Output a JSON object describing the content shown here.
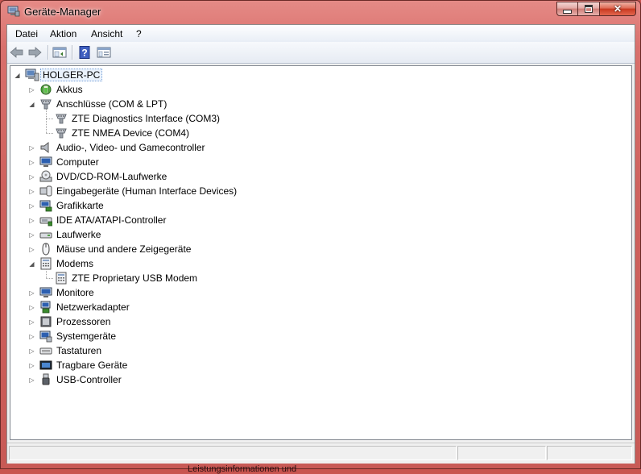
{
  "window": {
    "title": "Geräte-Manager",
    "caption": {
      "minimize": "minimize",
      "maximize": "maximize",
      "close": "close"
    }
  },
  "menu": [
    "Datei",
    "Aktion",
    "Ansicht",
    "?"
  ],
  "toolbar": {
    "buttons": [
      "back-arrow-icon",
      "forward-arrow-icon",
      "show-hide-console-tree-icon",
      "help-icon",
      "properties-view-icon"
    ]
  },
  "tree": {
    "root": {
      "label": "HOLGER-PC",
      "icon": "computer-icon",
      "expanded": true,
      "selected": true
    },
    "items": [
      {
        "label": "Akkus",
        "icon": "battery-icon",
        "expanded": false,
        "level": 1
      },
      {
        "label": "Anschlüsse (COM & LPT)",
        "icon": "port-icon",
        "expanded": true,
        "level": 1
      },
      {
        "label": "ZTE Diagnostics Interface (COM3)",
        "icon": "port-icon",
        "level": 2
      },
      {
        "label": "ZTE NMEA Device (COM4)",
        "icon": "port-icon",
        "level": 2
      },
      {
        "label": "Audio-, Video- und Gamecontroller",
        "icon": "speaker-icon",
        "expanded": false,
        "level": 1
      },
      {
        "label": "Computer",
        "icon": "monitor-icon",
        "expanded": false,
        "level": 1
      },
      {
        "label": "DVD/CD-ROM-Laufwerke",
        "icon": "disc-drive-icon",
        "expanded": false,
        "level": 1
      },
      {
        "label": "Eingabegeräte (Human Interface Devices)",
        "icon": "hid-icon",
        "expanded": false,
        "level": 1
      },
      {
        "label": "Grafikkarte",
        "icon": "display-adapter-icon",
        "expanded": false,
        "level": 1
      },
      {
        "label": "IDE ATA/ATAPI-Controller",
        "icon": "ide-controller-icon",
        "expanded": false,
        "level": 1
      },
      {
        "label": "Laufwerke",
        "icon": "disk-drive-icon",
        "expanded": false,
        "level": 1
      },
      {
        "label": "Mäuse und andere Zeigegeräte",
        "icon": "mouse-icon",
        "expanded": false,
        "level": 1
      },
      {
        "label": "Modems",
        "icon": "modem-icon",
        "expanded": true,
        "level": 1
      },
      {
        "label": "ZTE Proprietary USB Modem",
        "icon": "modem-icon",
        "level": 2
      },
      {
        "label": "Monitore",
        "icon": "monitor-icon",
        "expanded": false,
        "level": 1
      },
      {
        "label": "Netzwerkadapter",
        "icon": "network-adapter-icon",
        "expanded": false,
        "level": 1
      },
      {
        "label": "Prozessoren",
        "icon": "processor-icon",
        "expanded": false,
        "level": 1
      },
      {
        "label": "Systemgeräte",
        "icon": "system-device-icon",
        "expanded": false,
        "level": 1
      },
      {
        "label": "Tastaturen",
        "icon": "keyboard-icon",
        "expanded": false,
        "level": 1
      },
      {
        "label": "Tragbare Geräte",
        "icon": "portable-device-icon",
        "expanded": false,
        "level": 1
      },
      {
        "label": "USB-Controller",
        "icon": "usb-icon",
        "expanded": false,
        "level": 1
      }
    ]
  },
  "background": {
    "partial_text": "Leistungsinformationen und"
  },
  "colors": {
    "frame": "#c85a56",
    "selection": "#eaf2fc",
    "close_button": "#c8381f"
  }
}
